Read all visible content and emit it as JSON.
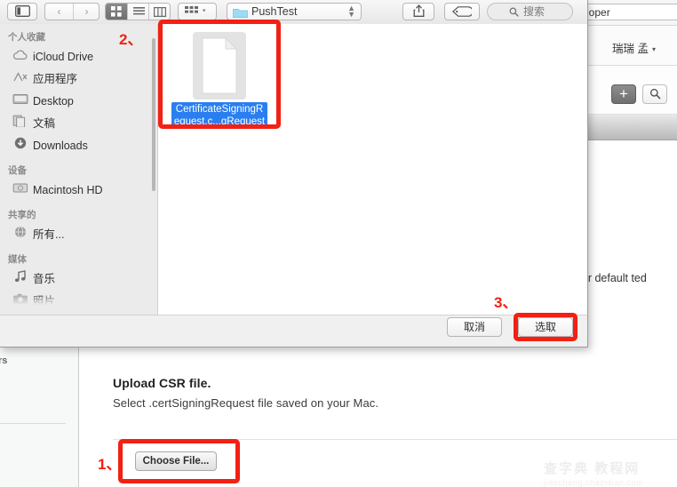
{
  "background_page": {
    "url_field_value": "loper",
    "user_menu": {
      "name": "瑞瑞 孟",
      "caret": "▾"
    },
    "add_button_label": "+",
    "search_button_icon": "search-icon",
    "body_text_fragment": ". Your default ted",
    "left_panel_fragment": "rs",
    "csr_section": {
      "heading": "Upload CSR file.",
      "subtext": "Select .certSigningRequest file saved on your Mac.",
      "choose_file_label": "Choose File..."
    },
    "watermark": {
      "line1": "查字典 教程网",
      "line2": "jiaocheng.chazidian.com"
    }
  },
  "finder_dialog": {
    "toolbar": {
      "sidebar_toggle_icon": "sidebar-toggle-icon",
      "back_label": "‹",
      "forward_label": "›",
      "view_icon_label": "icon-view-icon",
      "view_list_label": "list-view-icon",
      "view_column_label": "column-view-icon",
      "arrange_label": "arrange-by-icon",
      "path_folder_name": "PushTest",
      "share_icon": "share-icon",
      "tag_icon": "tag-icon",
      "search_placeholder": "搜索"
    },
    "sidebar": {
      "groups": [
        {
          "title": "个人收藏",
          "items": [
            {
              "label": "iCloud Drive",
              "icon": "cloud-icon"
            },
            {
              "label": "应用程序",
              "icon": "applications-icon"
            },
            {
              "label": "Desktop",
              "icon": "desktop-icon"
            },
            {
              "label": "文稿",
              "icon": "documents-icon"
            },
            {
              "label": "Downloads",
              "icon": "downloads-icon"
            }
          ]
        },
        {
          "title": "设备",
          "items": [
            {
              "label": "Macintosh HD",
              "icon": "harddisk-icon"
            }
          ]
        },
        {
          "title": "共享的",
          "items": [
            {
              "label": "所有...",
              "icon": "network-icon"
            }
          ]
        },
        {
          "title": "媒体",
          "items": [
            {
              "label": "音乐",
              "icon": "music-note-icon"
            },
            {
              "label": "照片",
              "icon": "camera-icon"
            }
          ]
        }
      ]
    },
    "files": [
      {
        "name": "CertificateSigningRequest.c...gRequest",
        "selected": true,
        "icon": "blank-document-icon"
      }
    ],
    "footer": {
      "cancel_label": "取消",
      "choose_label": "选取"
    }
  },
  "annotations": {
    "step1": "1、",
    "step2": "2、",
    "step3": "3、",
    "color": "#f32013"
  }
}
